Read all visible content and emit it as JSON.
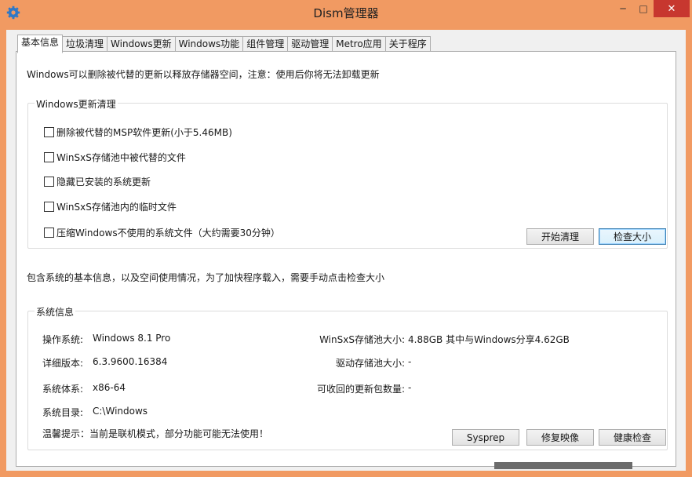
{
  "window": {
    "title": "Dism管理器",
    "minimize": "─",
    "maximize": "□",
    "close": "✕",
    "icon": "gear-icon"
  },
  "tabs": [
    {
      "label": "基本信息",
      "active": true
    },
    {
      "label": "垃圾清理"
    },
    {
      "label": "Windows更新"
    },
    {
      "label": "Windows功能"
    },
    {
      "label": "组件管理"
    },
    {
      "label": "驱动管理"
    },
    {
      "label": "Metro应用"
    },
    {
      "label": "关于程序"
    }
  ],
  "cleanup": {
    "description": "Windows可以删除被代替的更新以释放存储器空间，注意：使用后你将无法卸载更新",
    "group_title": "Windows更新清理",
    "options": [
      {
        "label": "删除被代替的MSP软件更新(小于5.46MB)",
        "checked": false
      },
      {
        "label": "WinSxS存储池中被代替的文件",
        "checked": false
      },
      {
        "label": "隐藏已安装的系统更新",
        "checked": false
      },
      {
        "label": "WinSxS存储池内的临时文件",
        "checked": false
      },
      {
        "label": "压缩Windows不使用的系统文件（大约需要30分钟）",
        "checked": false
      }
    ],
    "start_button": "开始清理",
    "check_size_button": "检查大小"
  },
  "sysinfo": {
    "description": "包含系统的基本信息，以及空间使用情况，为了加快程序载入，需要手动点击检查大小",
    "group_title": "系统信息",
    "os_label": "操作系统:",
    "os_value": "Windows 8.1 Pro",
    "version_label": "详细版本:",
    "version_value": "6.3.9600.16384",
    "arch_label": "系统体系:",
    "arch_value": "x86-64",
    "dir_label": "系统目录:",
    "dir_value": "C:\\Windows",
    "tip": "温馨提示：当前是联机模式，部分功能可能无法使用！",
    "winsxs_label": "WinSxS存储池大小:",
    "winsxs_value": "4.88GB  其中与Windows分享4.62GB",
    "driver_label": "驱动存储池大小:",
    "driver_value": "-",
    "reclaim_label": "可收回的更新包数量:",
    "reclaim_value": "-",
    "sysprep_button": "Sysprep",
    "repair_button": "修复映像",
    "health_button": "健康检查"
  }
}
